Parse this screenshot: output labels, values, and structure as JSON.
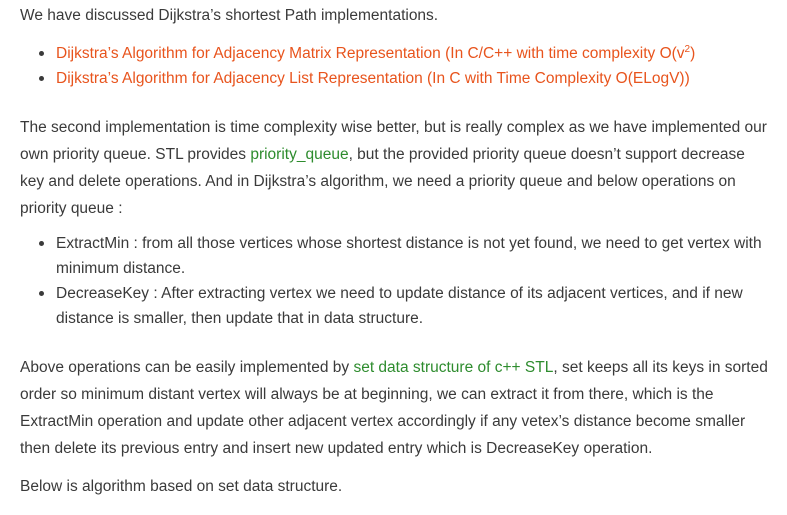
{
  "intro": "We have discussed Dijkstra’s shortest Path implementations.",
  "links": [
    {
      "text": "Dijkstra’s Algorithm for Adjacency Matrix Representation (In C/C++ with time complexity O(v",
      "sup": "2",
      "tail": ")"
    },
    {
      "text": "Dijkstra’s Algorithm for Adjacency List Representation (In C with Time Complexity O(ELogV))"
    }
  ],
  "para2": {
    "part1": "The second implementation is time complexity wise better, but is really complex as we have implemented our own priority queue. STL provides ",
    "link": "priority_queue",
    "part2": ", but the provided priority queue doesn’t support decrease key and delete operations. And in Dijkstra’s algorithm, we need a priority queue and below operations on priority queue :"
  },
  "ops": [
    "ExtractMin : from all those vertices whose shortest distance is not yet found, we need to get vertex with minimum distance.",
    "DecreaseKey : After extracting vertex we need to update distance of its adjacent vertices, and if new distance is smaller, then update that in data structure."
  ],
  "para3": {
    "part1": "Above operations can be easily implemented by ",
    "link": "set data structure of c++ STL",
    "part2": ", set keeps all its keys in sorted order so minimum distant vertex will always be at beginning, we can extract it from there, which is the ExtractMin operation and update other adjacent vertex accordingly if any vetex’s distance become smaller then delete its previous entry and insert new updated entry which is DecreaseKey operation."
  },
  "para4": "Below is algorithm based on set data structure.",
  "colors": {
    "link_orange": "#e8541d",
    "link_green": "#2e8c2e",
    "text": "#3a3a3a"
  }
}
